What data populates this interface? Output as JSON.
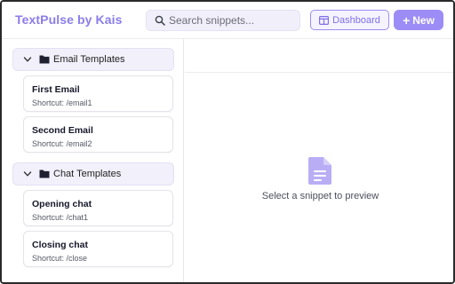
{
  "app": {
    "brand": "TextPulse by Kais"
  },
  "header": {
    "search_placeholder": "Search snippets...",
    "dashboard_label": "Dashboard",
    "new_label": "New",
    "accent_color": "#9c8cf5"
  },
  "sidebar": {
    "folders": [
      {
        "label": "Email Templates",
        "expanded": true,
        "snippets": [
          {
            "title": "First Email",
            "shortcut": "Shortcut: /email1"
          },
          {
            "title": "Second Email",
            "shortcut": "Shortcut: /email2"
          }
        ]
      },
      {
        "label": "Chat Templates",
        "expanded": true,
        "snippets": [
          {
            "title": "Opening chat",
            "shortcut": "Shortcut: /chat1"
          },
          {
            "title": "Closing chat",
            "shortcut": "Shortcut: /close"
          }
        ]
      }
    ]
  },
  "preview": {
    "empty_text": "Select a snippet to preview",
    "icon": "document-icon"
  }
}
